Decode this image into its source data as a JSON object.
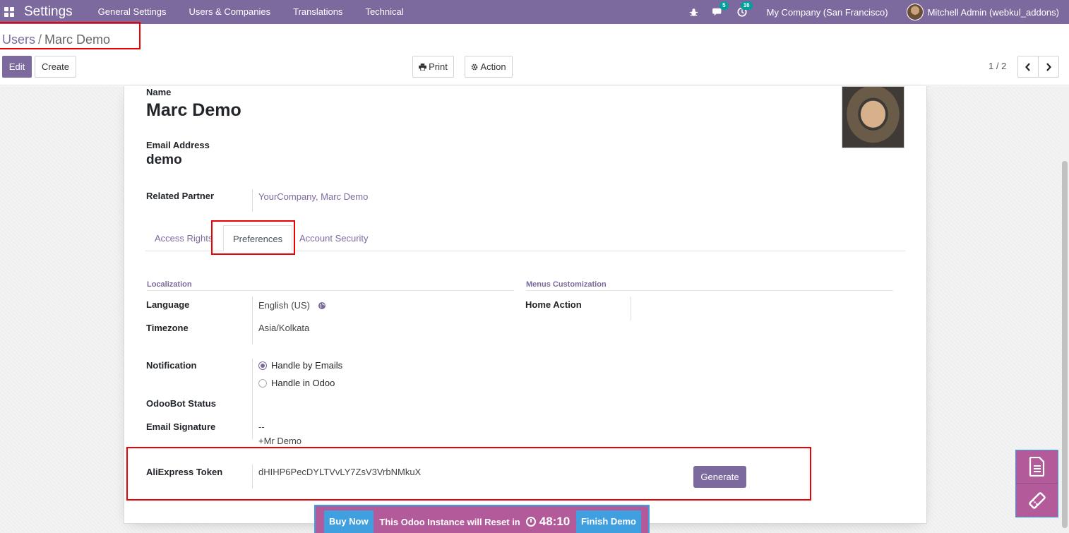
{
  "navbar": {
    "brand": "Settings",
    "menu": [
      "General Settings",
      "Users & Companies",
      "Translations",
      "Technical"
    ],
    "messages_count": "5",
    "activities_count": "16",
    "company": "My Company (San Francisco)",
    "user": "Mitchell Admin (webkul_addons)"
  },
  "breadcrumb": {
    "parent": "Users",
    "separator": "/",
    "current": "Marc Demo"
  },
  "toolbar": {
    "edit": "Edit",
    "create": "Create",
    "print": "Print",
    "action": "Action",
    "pager": "1 / 2"
  },
  "form": {
    "name_label": "Name",
    "name": "Marc Demo",
    "email_label": "Email Address",
    "email": "demo",
    "partner_label": "Related Partner",
    "partner": "YourCompany, Marc Demo",
    "tabs": [
      "Access Rights",
      "Preferences",
      "Account Security"
    ],
    "localization_title": "Localization",
    "menus_title": "Menus Customization",
    "language_label": "Language",
    "language": "English (US)",
    "timezone_label": "Timezone",
    "timezone": "Asia/Kolkata",
    "home_action_label": "Home Action",
    "notification_label": "Notification",
    "notification_options": [
      "Handle by Emails",
      "Handle in Odoo"
    ],
    "notification_selected": "Handle by Emails",
    "odoobot_label": "OdooBot Status",
    "signature_label": "Email Signature",
    "signature_line1": "--",
    "signature_line2": "+Mr Demo",
    "token_label": "AliExpress Token",
    "token": "dHIHP6PecDYLTVvLY7ZsV3VrbNMkuX",
    "generate": "Generate"
  },
  "demo": {
    "buy_now": "Buy Now",
    "reset_text": "This Odoo Instance will Reset in",
    "timer": "48:10",
    "finish": "Finish Demo"
  },
  "colors": {
    "primary": "#7c6a9e",
    "demo_bar": "#b35a9a",
    "demo_button": "#3f9fdf",
    "highlight": "#e00000"
  }
}
